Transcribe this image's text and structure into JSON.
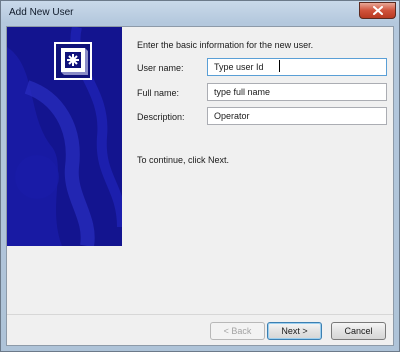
{
  "window": {
    "title": "Add New User"
  },
  "wizard": {
    "intro": "Enter the basic information for the new user.",
    "fields": [
      {
        "label": "User name:",
        "value": "Type user Id"
      },
      {
        "label": "Full name:",
        "value": "type full name"
      },
      {
        "label": "Description:",
        "value": "Operator"
      }
    ],
    "continue_text": "To continue, click Next."
  },
  "buttons": {
    "back": "< Back",
    "next": "Next >",
    "cancel": "Cancel"
  },
  "colors": {
    "banner": "#13148f",
    "close": "#c8452f"
  },
  "icons": {
    "close": "close-icon",
    "logo": "user-logo-icon"
  }
}
